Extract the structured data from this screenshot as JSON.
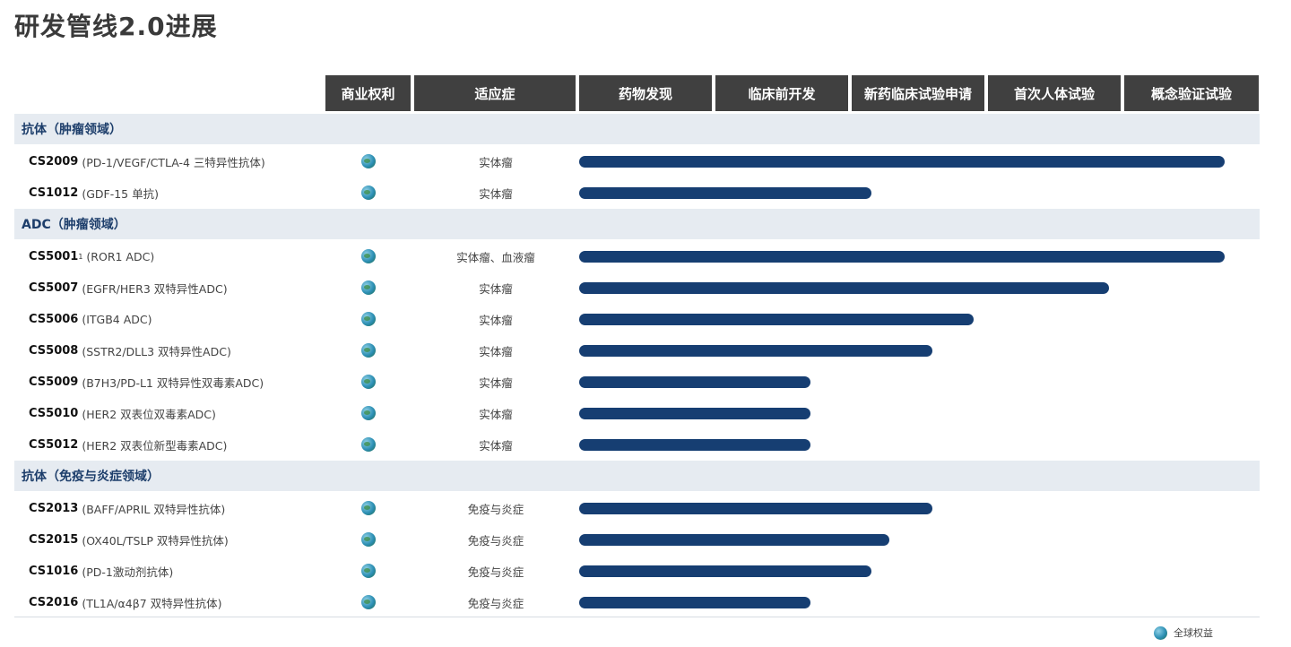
{
  "title": "研发管线2.0进展",
  "legend": {
    "label": "全球权益",
    "icon": "globe-icon"
  },
  "colors": {
    "bar": "#163e72",
    "header_bg": "#404040",
    "section_bg": "#e6ebf1",
    "section_text": "#1d3e6b"
  },
  "chart_data": {
    "type": "bar",
    "orientation": "horizontal",
    "title": "研发管线2.0进展",
    "columns": [
      "商业权利",
      "适应症",
      "药物发现",
      "临床前开发",
      "新药临床试验申请",
      "首次人体试验",
      "概念验证试验"
    ],
    "stages": [
      "药物发现",
      "临床前开发",
      "新药临床试验申请",
      "首次人体试验",
      "概念验证试验"
    ],
    "value_unit": "stages completed (0-5)",
    "xlim": [
      0,
      5
    ],
    "sections": [
      {
        "label": "抗体（肿瘤领域）",
        "items": [
          {
            "code": "CS2009",
            "sup": "",
            "desc": "(PD-1/VEGF/CTLA-4 三特异性抗体)",
            "rights": "全球权益",
            "indication": "实体瘤",
            "value": 4.75
          },
          {
            "code": "CS1012",
            "sup": "",
            "desc": "(GDF-15 单抗)",
            "rights": "全球权益",
            "indication": "实体瘤",
            "value": 2.15
          }
        ]
      },
      {
        "label": "ADC（肿瘤领域）",
        "items": [
          {
            "code": "CS5001",
            "sup": "1",
            "desc": "(ROR1 ADC)",
            "rights": "全球权益",
            "indication": "实体瘤、血液瘤",
            "value": 4.75
          },
          {
            "code": "CS5007",
            "sup": "",
            "desc": "(EGFR/HER3 双特异性ADC)",
            "rights": "全球权益",
            "indication": "实体瘤",
            "value": 3.9
          },
          {
            "code": "CS5006",
            "sup": "",
            "desc": "(ITGB4 ADC)",
            "rights": "全球权益",
            "indication": "实体瘤",
            "value": 2.9
          },
          {
            "code": "CS5008",
            "sup": "",
            "desc": "(SSTR2/DLL3 双特异性ADC)",
            "rights": "全球权益",
            "indication": "实体瘤",
            "value": 2.6
          },
          {
            "code": "CS5009",
            "sup": "",
            "desc": "(B7H3/PD-L1 双特异性双毒素ADC)",
            "rights": "全球权益",
            "indication": "实体瘤",
            "value": 1.7
          },
          {
            "code": "CS5010",
            "sup": "",
            "desc": "(HER2 双表位双毒素ADC)",
            "rights": "全球权益",
            "indication": "实体瘤",
            "value": 1.7
          },
          {
            "code": "CS5012",
            "sup": "",
            "desc": "(HER2 双表位新型毒素ADC)",
            "rights": "全球权益",
            "indication": "实体瘤",
            "value": 1.7
          }
        ]
      },
      {
        "label": "抗体（免疫与炎症领域）",
        "items": [
          {
            "code": "CS2013",
            "sup": "",
            "desc": "(BAFF/APRIL 双特异性抗体)",
            "rights": "全球权益",
            "indication": "免疫与炎症",
            "value": 2.6
          },
          {
            "code": "CS2015",
            "sup": "",
            "desc": "(OX40L/TSLP 双特异性抗体)",
            "rights": "全球权益",
            "indication": "免疫与炎症",
            "value": 2.28
          },
          {
            "code": "CS1016",
            "sup": "",
            "desc": "(PD-1激动剂抗体)",
            "rights": "全球权益",
            "indication": "免疫与炎症",
            "value": 2.15
          },
          {
            "code": "CS2016",
            "sup": "",
            "desc": "(TL1A/α4β7 双特异性抗体)",
            "rights": "全球权益",
            "indication": "免疫与炎症",
            "value": 1.7
          }
        ]
      }
    ]
  }
}
